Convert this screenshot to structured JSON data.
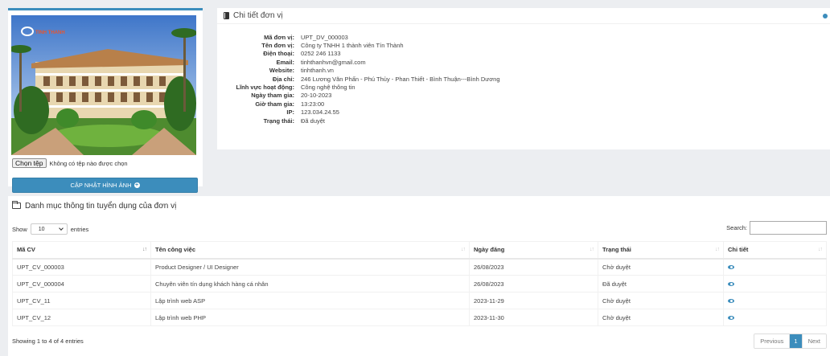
{
  "image_panel": {
    "logo_text": "TINH THANH",
    "file_button_label": "Chọn tệp",
    "file_status": "Không có tệp nào được chọn",
    "update_button_label": "CẬP NHẬT HÌNH ẢNH"
  },
  "detail": {
    "title": "Chi tiết đơn vị",
    "fields": [
      {
        "label": "Mã đơn vị:",
        "value": "UPT_DV_000003"
      },
      {
        "label": "Tên đơn vị:",
        "value": "Công ty TNHH 1 thành viên Tín Thành"
      },
      {
        "label": "Điện thoại:",
        "value": "0252 246 1133"
      },
      {
        "label": "Email:",
        "value": "tinhthanhvn@gmail.com"
      },
      {
        "label": "Website:",
        "value": "tinhthanh.vn"
      },
      {
        "label": "Địa chỉ:",
        "value": "246 Lương Văn Phấn - Phú Thủy - Phan Thiết - Bình Thuận---Bình Dương"
      },
      {
        "label": "Lĩnh vực hoạt động:",
        "value": "Công nghệ thông tin"
      },
      {
        "label": "Ngày tham gia:",
        "value": "20-10-2023"
      },
      {
        "label": "Giờ tham gia:",
        "value": "13:23:00"
      },
      {
        "label": "IP:",
        "value": "123.034.24.55"
      },
      {
        "label": "Trạng thái:",
        "value": "Đã duyệt"
      }
    ]
  },
  "jobs": {
    "title": "Danh mục thông tin tuyển dụng của đơn vị",
    "show_label": "Show",
    "entries_label": "entries",
    "page_length": "10",
    "search_label": "Search:",
    "columns": [
      "Mã CV",
      "Tên công việc",
      "Ngày đăng",
      "Trạng thái",
      "Chi tiết"
    ],
    "rows": [
      {
        "code": "UPT_CV_000003",
        "name": "Product Designer / UI Designer",
        "date": "26/08/2023",
        "status": "Chờ duyệt"
      },
      {
        "code": "UPT_CV_000004",
        "name": "Chuyên viên tín dụng khách hàng cá nhân",
        "date": "26/08/2023",
        "status": "Đã duyệt"
      },
      {
        "code": "UPT_CV_11",
        "name": "Lập trình web ASP",
        "date": "2023-11-29",
        "status": "Chờ duyệt"
      },
      {
        "code": "UPT_CV_12",
        "name": "Lập trình web PHP",
        "date": "2023-11-30",
        "status": "Chờ duyệt"
      }
    ],
    "info": "Showing 1 to 4 of 4 entries",
    "pagination": {
      "previous": "Previous",
      "current": "1",
      "next": "Next"
    }
  },
  "colors": {
    "accent": "#3c8dbc",
    "background": "#eceef1"
  },
  "icons": {
    "detail": "book-icon",
    "collapse": "minus-circle-icon",
    "jobs": "folder-open-icon",
    "view": "eye-icon",
    "update": "plus-circle-icon"
  }
}
